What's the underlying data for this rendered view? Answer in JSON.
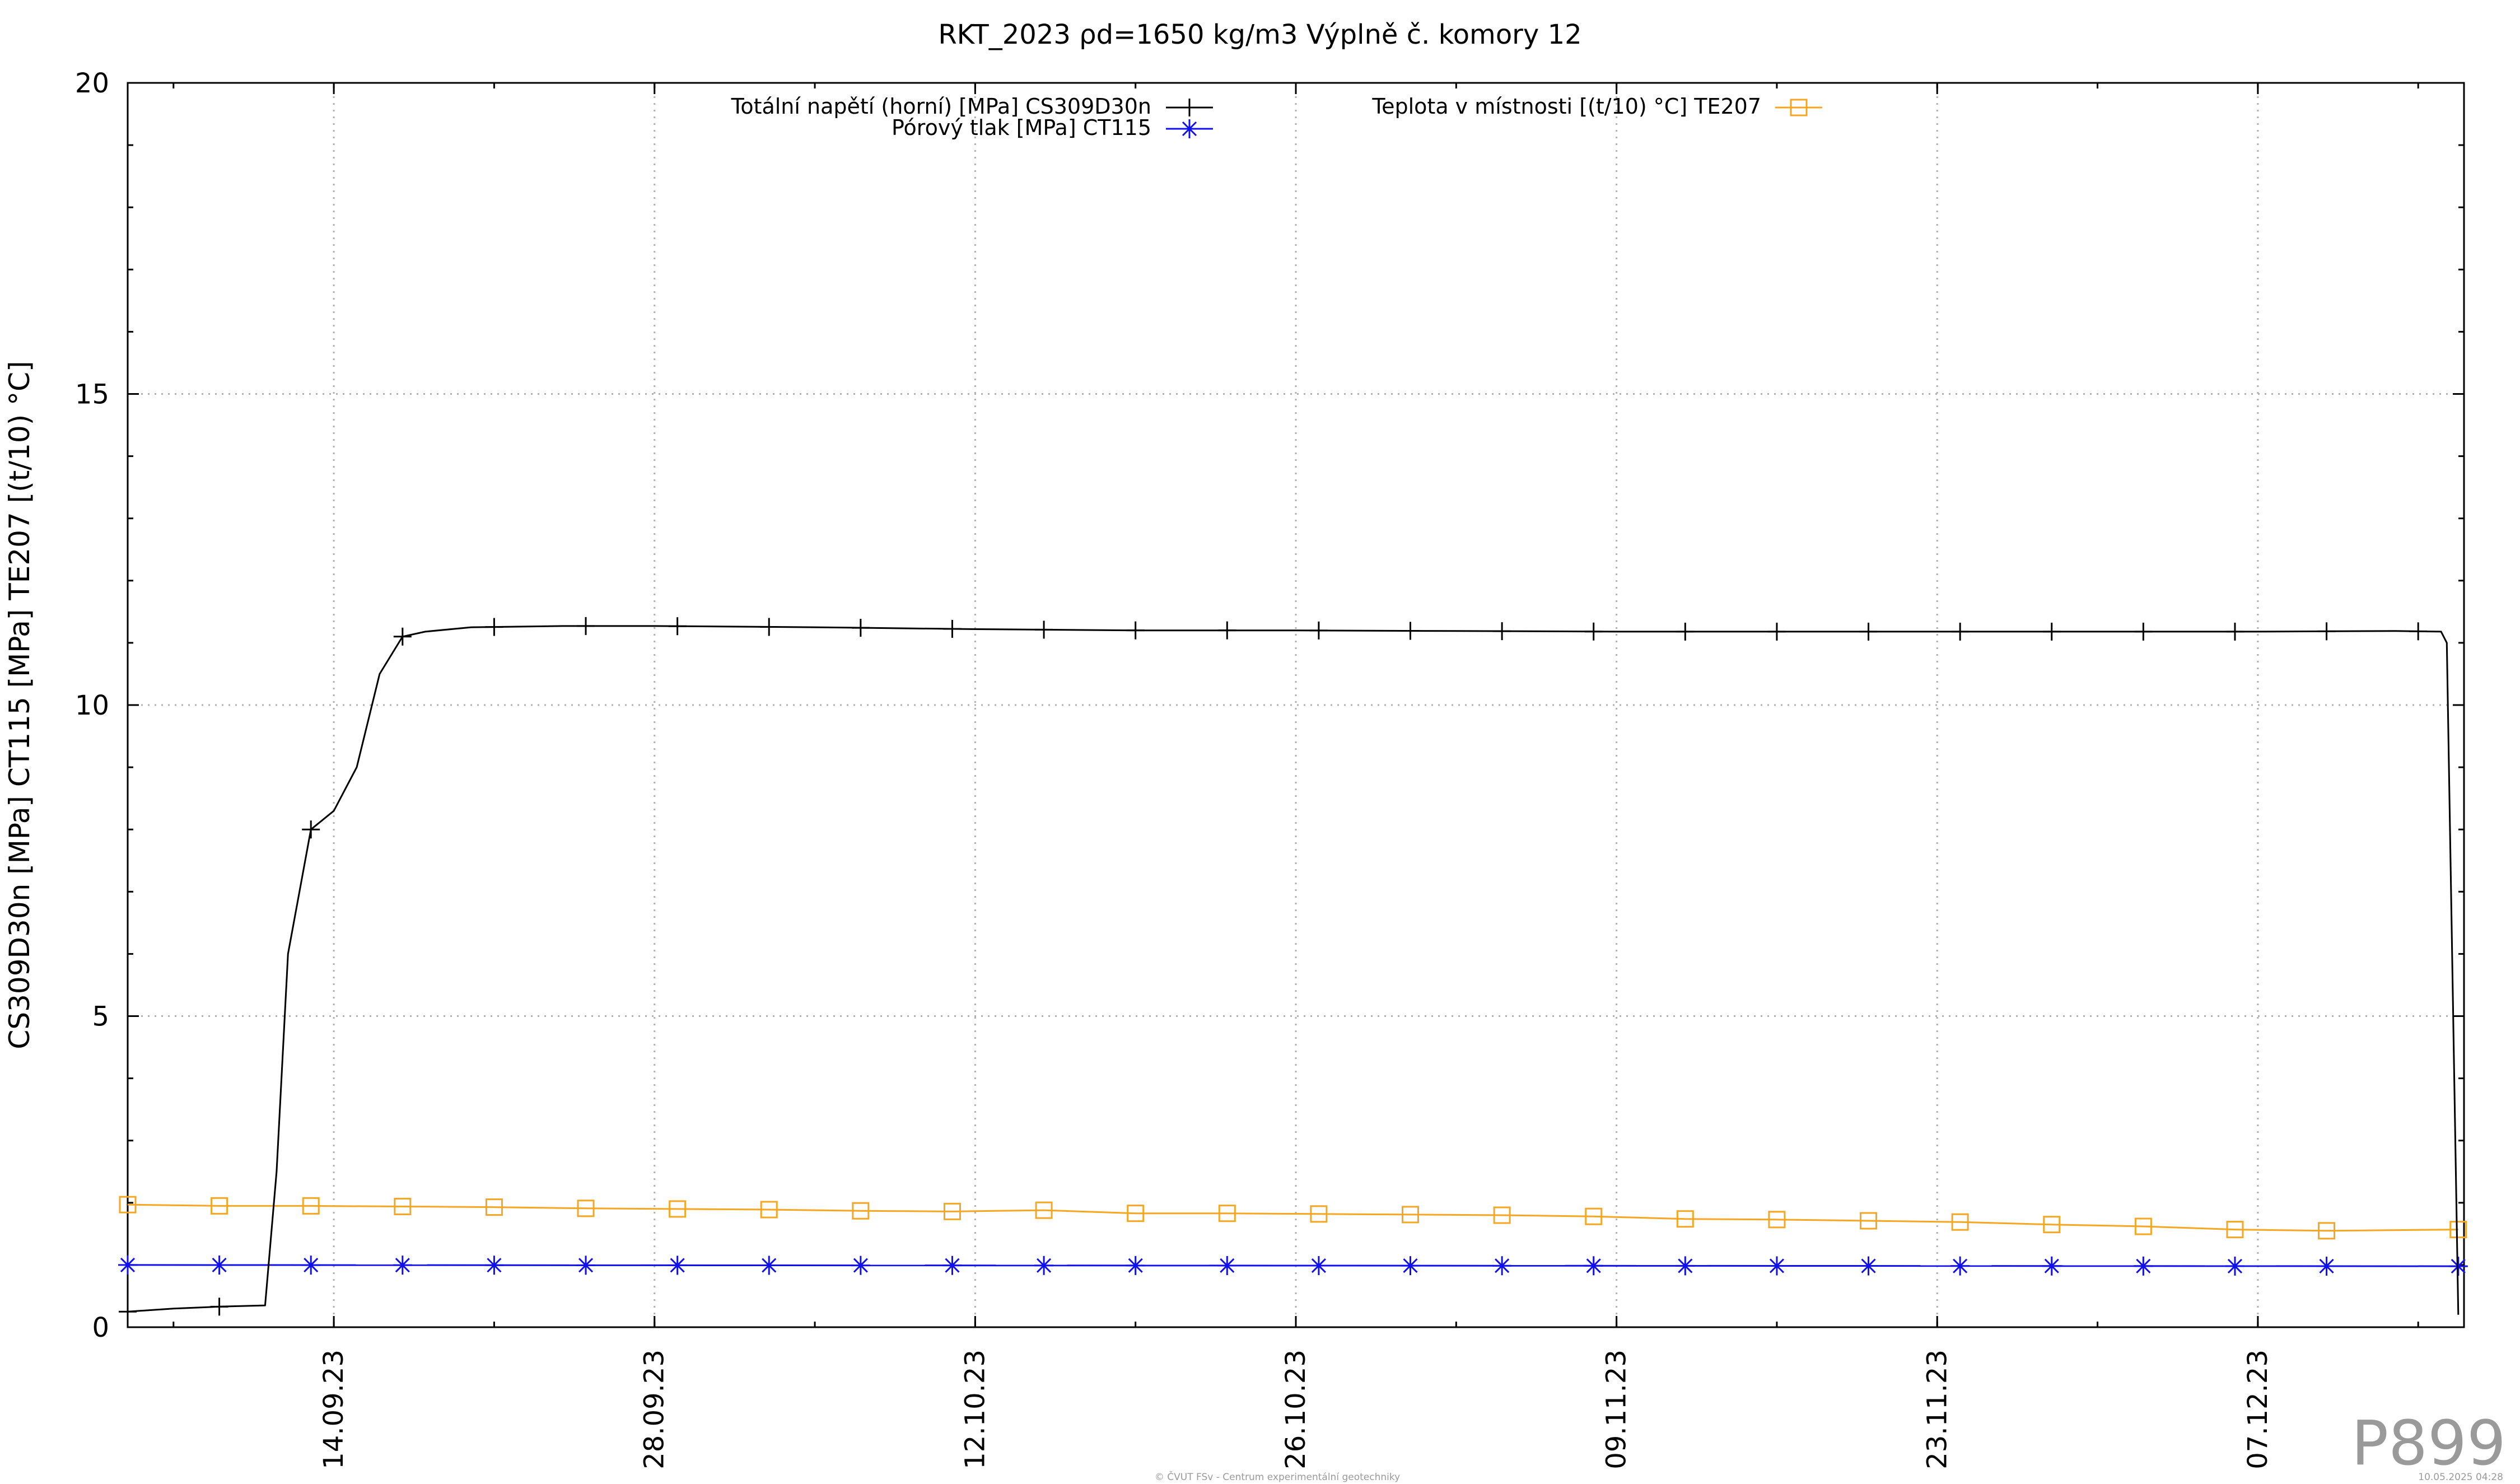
{
  "chart_data": {
    "type": "line",
    "title": "RKT_2023 ρd=1650 kg/m3 Výplně č. komory 12",
    "ylabel": "CS309D30n [MPa] CT115 [MPa] TE207 [(t/10) °C]",
    "xlabel": "",
    "xlim": [
      "2023-09-05",
      "2023-12-16"
    ],
    "ylim": [
      0,
      20
    ],
    "yticks": [
      0,
      5,
      10,
      15,
      20
    ],
    "xticks": [
      "14.09.23",
      "28.09.23",
      "12.10.23",
      "26.10.23",
      "09.11.23",
      "23.11.23",
      "07.12.23"
    ],
    "xtick_dates": [
      "2023-09-14",
      "2023-09-28",
      "2023-10-12",
      "2023-10-26",
      "2023-11-09",
      "2023-11-23",
      "2023-12-07"
    ],
    "grid": true,
    "legend_position": "top",
    "series": [
      {
        "name": "Totální napětí (horní) [MPa] CS309D30n",
        "color": "#000000",
        "marker": "plus",
        "x": [
          "2023-09-05",
          "2023-09-07",
          "2023-09-09",
          "2023-09-11",
          "2023-09-11 12:00",
          "2023-09-12",
          "2023-09-13",
          "2023-09-14",
          "2023-09-15",
          "2023-09-16",
          "2023-09-17",
          "2023-09-18",
          "2023-09-20",
          "2023-09-24",
          "2023-09-28",
          "2023-10-05",
          "2023-10-12",
          "2023-10-19",
          "2023-10-26",
          "2023-11-02",
          "2023-11-09",
          "2023-11-16",
          "2023-11-23",
          "2023-11-30",
          "2023-12-07",
          "2023-12-13",
          "2023-12-15",
          "2023-12-15 06:00",
          "2023-12-15 18:00"
        ],
        "y": [
          0.25,
          0.3,
          0.33,
          0.35,
          2.5,
          6.0,
          8.0,
          8.3,
          9.0,
          10.5,
          11.1,
          11.18,
          11.25,
          11.27,
          11.27,
          11.25,
          11.22,
          11.2,
          11.2,
          11.19,
          11.18,
          11.18,
          11.18,
          11.18,
          11.18,
          11.19,
          11.18,
          11.0,
          0.2
        ],
        "marker_x": [
          "2023-09-05",
          "2023-09-09",
          "2023-09-13",
          "2023-09-17",
          "2023-09-21",
          "2023-09-25",
          "2023-09-29",
          "2023-10-03",
          "2023-10-07",
          "2023-10-11",
          "2023-10-15",
          "2023-10-19",
          "2023-10-23",
          "2023-10-27",
          "2023-10-31",
          "2023-11-04",
          "2023-11-08",
          "2023-11-12",
          "2023-11-16",
          "2023-11-20",
          "2023-11-24",
          "2023-11-28",
          "2023-12-02",
          "2023-12-06",
          "2023-12-10",
          "2023-12-14"
        ]
      },
      {
        "name": "Pórový tlak [MPa] CT115",
        "color": "#1010ee",
        "marker": "star",
        "x": [
          "2023-09-05",
          "2023-12-15 18:00"
        ],
        "y": [
          1.0,
          0.98
        ],
        "marker_x": [
          "2023-09-05",
          "2023-09-09",
          "2023-09-13",
          "2023-09-17",
          "2023-09-21",
          "2023-09-25",
          "2023-09-29",
          "2023-10-03",
          "2023-10-07",
          "2023-10-11",
          "2023-10-15",
          "2023-10-19",
          "2023-10-23",
          "2023-10-27",
          "2023-10-31",
          "2023-11-04",
          "2023-11-08",
          "2023-11-12",
          "2023-11-16",
          "2023-11-20",
          "2023-11-24",
          "2023-11-28",
          "2023-12-02",
          "2023-12-06",
          "2023-12-10",
          "2023-12-15 18:00"
        ]
      },
      {
        "name": "Teplota v místnosti [(t/10) °C] TE207",
        "color": "#f5a623",
        "marker": "square",
        "x": [
          "2023-09-05",
          "2023-09-09",
          "2023-09-13",
          "2023-09-17",
          "2023-09-21",
          "2023-09-25",
          "2023-09-29",
          "2023-10-03",
          "2023-10-07",
          "2023-10-11",
          "2023-10-15",
          "2023-10-19",
          "2023-10-23",
          "2023-10-27",
          "2023-10-31",
          "2023-11-04",
          "2023-11-08",
          "2023-11-12",
          "2023-11-16",
          "2023-11-20",
          "2023-11-24",
          "2023-11-28",
          "2023-12-02",
          "2023-12-06",
          "2023-12-10",
          "2023-12-15 18:00"
        ],
        "y": [
          1.97,
          1.95,
          1.95,
          1.94,
          1.93,
          1.91,
          1.9,
          1.89,
          1.87,
          1.86,
          1.88,
          1.83,
          1.83,
          1.82,
          1.81,
          1.8,
          1.78,
          1.74,
          1.73,
          1.71,
          1.69,
          1.65,
          1.62,
          1.57,
          1.55,
          1.57
        ],
        "marker_x": [
          "2023-09-05",
          "2023-09-09",
          "2023-09-13",
          "2023-09-17",
          "2023-09-21",
          "2023-09-25",
          "2023-09-29",
          "2023-10-03",
          "2023-10-07",
          "2023-10-11",
          "2023-10-15",
          "2023-10-19",
          "2023-10-23",
          "2023-10-27",
          "2023-10-31",
          "2023-11-04",
          "2023-11-08",
          "2023-11-12",
          "2023-11-16",
          "2023-11-20",
          "2023-11-24",
          "2023-11-28",
          "2023-12-02",
          "2023-12-06",
          "2023-12-10",
          "2023-12-15 18:00"
        ]
      }
    ]
  },
  "watermark": "P899",
  "footer_center": "© ČVUT FSv - Centrum experimentální geotechniky",
  "footer_right": "10.05.2025 04:28"
}
